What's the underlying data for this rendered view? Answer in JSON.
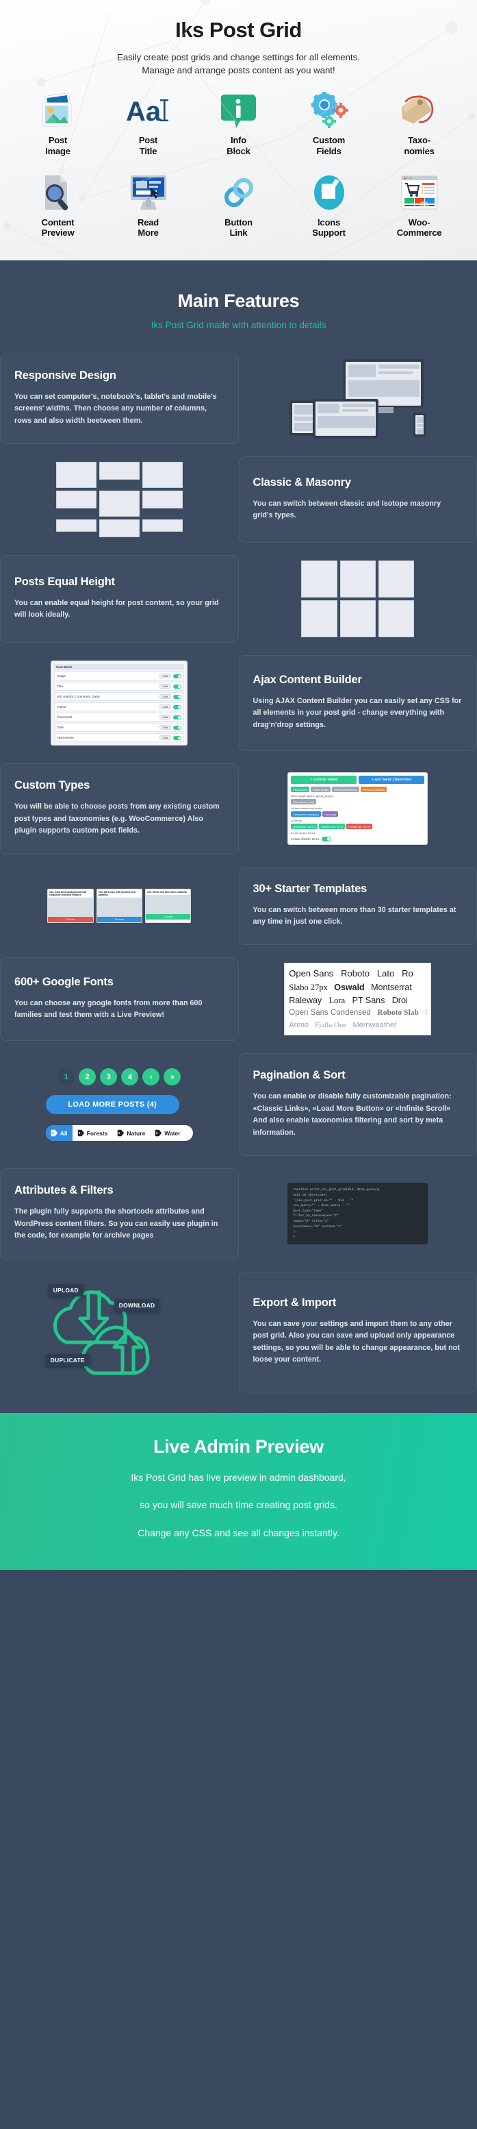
{
  "hero": {
    "title": "Iks Post Grid",
    "subtitle_line1": "Easily create post grids and change settings for all elements.",
    "subtitle_line2": "Manage and arrange posts content as you want!",
    "icons_row1": [
      {
        "label_line1": "Post",
        "label_line2": "Image",
        "icon": "post-image-icon"
      },
      {
        "label_line1": "Post",
        "label_line2": "Title",
        "icon": "post-title-icon"
      },
      {
        "label_line1": "Info",
        "label_line2": "Block",
        "icon": "info-block-icon"
      },
      {
        "label_line1": "Custom",
        "label_line2": "Fields",
        "icon": "custom-fields-icon"
      },
      {
        "label_line1": "Taxo-",
        "label_line2": "nomies",
        "icon": "taxonomies-icon"
      }
    ],
    "icons_row2": [
      {
        "label_line1": "Content",
        "label_line2": "Preview",
        "icon": "content-preview-icon"
      },
      {
        "label_line1": "Read",
        "label_line2": "More",
        "icon": "read-more-icon"
      },
      {
        "label_line1": "Button",
        "label_line2": "Link",
        "icon": "button-link-icon"
      },
      {
        "label_line1": "Icons",
        "label_line2": "Support",
        "icon": "icons-support-icon"
      },
      {
        "label_line1": "Woo-",
        "label_line2": "Commerce",
        "icon": "woocommerce-icon"
      }
    ]
  },
  "main": {
    "heading": "Main Features",
    "subheading": "Iks Post Grid made with attention to details"
  },
  "features": [
    {
      "title": "Responsive Design",
      "body": "You can set computer's, notebook's, tablet's and mobile's screens' widths. Then choose any number of columns, rows and also width beetween them."
    },
    {
      "title": "Classic & Masonry",
      "body": "You can switch between classic and Isotope masonry grid's types."
    },
    {
      "title": "Posts Equal Height",
      "body": "You can enable equal height for post content, so your grid will look ideally."
    },
    {
      "title": "Ajax Content Builder",
      "body": "Using AJAX Content Builder you can easily set any CSS for all elements in your post grid - change everything with drag'n'drop settings."
    },
    {
      "title": "Custom Types",
      "body": "You will be able to choose posts from any existing custom post types and taxonomies (e.g. WooCommerce) Also plugin supports custom post fields."
    },
    {
      "title": "30+ Starter Templates",
      "body": "You can switch between more than 30 starter templates at any time in just one click."
    },
    {
      "title": "600+ Google Fonts",
      "body": "You can choose any google fonts from more than 600 families and test them with a Live Preview!"
    },
    {
      "title": "Pagination & Sort",
      "body": "You can enable or disable fully customizable pagination: «Classic Links», «Load More Button» or «Infinite Scroll» And also enable taxonomies filtering and sort by meta information."
    },
    {
      "title": "Attributes & Filters",
      "body": "The plugin fully supports the shortcode attributes and WordPress content filters. So you can easily use plugin in the code, for example for archive pages"
    },
    {
      "title": "Export & Import",
      "body": "You can save your settings and import them to any other post grid. Also you can save and upload only appearance settings, so you will be able to change appearance, but not loose your content."
    }
  ],
  "builder": {
    "header": "Post Block",
    "rows": [
      {
        "name": "Image",
        "edit": "Edit"
      },
      {
        "name": "Title",
        "edit": "Edit"
      },
      {
        "name": "Info (Author, Comments, Date)",
        "edit": "Edit"
      },
      {
        "name": "Author",
        "edit": "Edit"
      },
      {
        "name": "Comments",
        "edit": "Edit"
      },
      {
        "name": "Date",
        "edit": "Edit"
      },
      {
        "name": "Taxonomies",
        "edit": "Edit"
      }
    ]
  },
  "taxonomy": {
    "btn_choose": "✓ CHOOSE TERMS",
    "btn_add": "+ ADD THESE CONDITIONS",
    "row1": [
      "Posts (post)",
      "Pages (page)",
      "Media (attachment)",
      "Products (product)"
    ],
    "label1": "About plugin (aсme_about_plugin)",
    "row2": [
      "Cars (acme_cars)"
    ],
    "label2": "All taxonomies and terms",
    "row3": [
      "Categories (category)",
      "Cars (car)"
    ],
    "label3": "All terms",
    "row4": [
      "Animals (id: 13) (1)",
      "Beaches (id: 7) (1)",
      "Forests (id: 10) (4)"
    ],
    "note": "for all chosen terms",
    "toggle_label": "Include children terms"
  },
  "templates": [
    {
      "title": "#11. Dark blue background with turquoise and blue buttons",
      "button": "Choose",
      "button_color": "#e2574c"
    },
    {
      "title": "#13. Dark blue with borders and padding",
      "button": "Choose",
      "button_color": "#2f8ede"
    },
    {
      "title": "#29. White and blue with shadows",
      "button": "Choose",
      "button_color": "#2ecc8f"
    }
  ],
  "fonts": {
    "rows": [
      [
        "Open Sans",
        "Roboto",
        "Lato",
        "Ro"
      ],
      [
        "Slabo 27px",
        "Oswald",
        "Montserrat"
      ],
      [
        "Raleway",
        "Lora",
        "PT Sans",
        "Droi"
      ],
      [
        "Open Sans Condensed",
        "Roboto Slab",
        "D"
      ],
      [
        "Arimo",
        "Fjalla One",
        "Merriweather"
      ]
    ]
  },
  "pagination": {
    "pages": [
      "1",
      "2",
      "3",
      "4",
      "›",
      "»"
    ],
    "active_index": 0,
    "load_more_label": "LOAD MORE POSTS (4)",
    "filters": [
      {
        "label": "All",
        "active": true
      },
      {
        "label": "Forests",
        "active": false
      },
      {
        "label": "Nature",
        "active": false
      },
      {
        "label": "Water",
        "active": false
      }
    ]
  },
  "code": {
    "lines": [
      "function print_iks_post_grid($id, $tax_query){",
      "  echo do_shortcode(",
      "    '[iks-post-grid id=\"' . $id . '\"",
      "      tax_query=\"' . $tax_query . '\"",
      "      post_type=\"news\"",
      "      filter_by_taxonomies=\"3\"",
      "      image=\"0\"  title=\"1\"",
      "      taxonomies=\"0\"  content=\"1\"",
      "  );",
      "}"
    ]
  },
  "cloud": {
    "tag_upload": "UPLOAD",
    "tag_download": "DOWNLOAD",
    "tag_duplicate": "DUPLICATE"
  },
  "footer": {
    "heading": "Live Admin Preview",
    "line1": "Iks Post Grid has live preview in admin dashboard,",
    "line2": "so you will save much time creating post grids.",
    "line3": "Change any CSS and see all changes instantly."
  },
  "colors": {
    "dark_bg": "#3c4b60",
    "card_bg": "#3f4e63",
    "accent_green": "#2ecc8f",
    "accent_blue": "#2f8ede",
    "teal": "#21c49a"
  }
}
